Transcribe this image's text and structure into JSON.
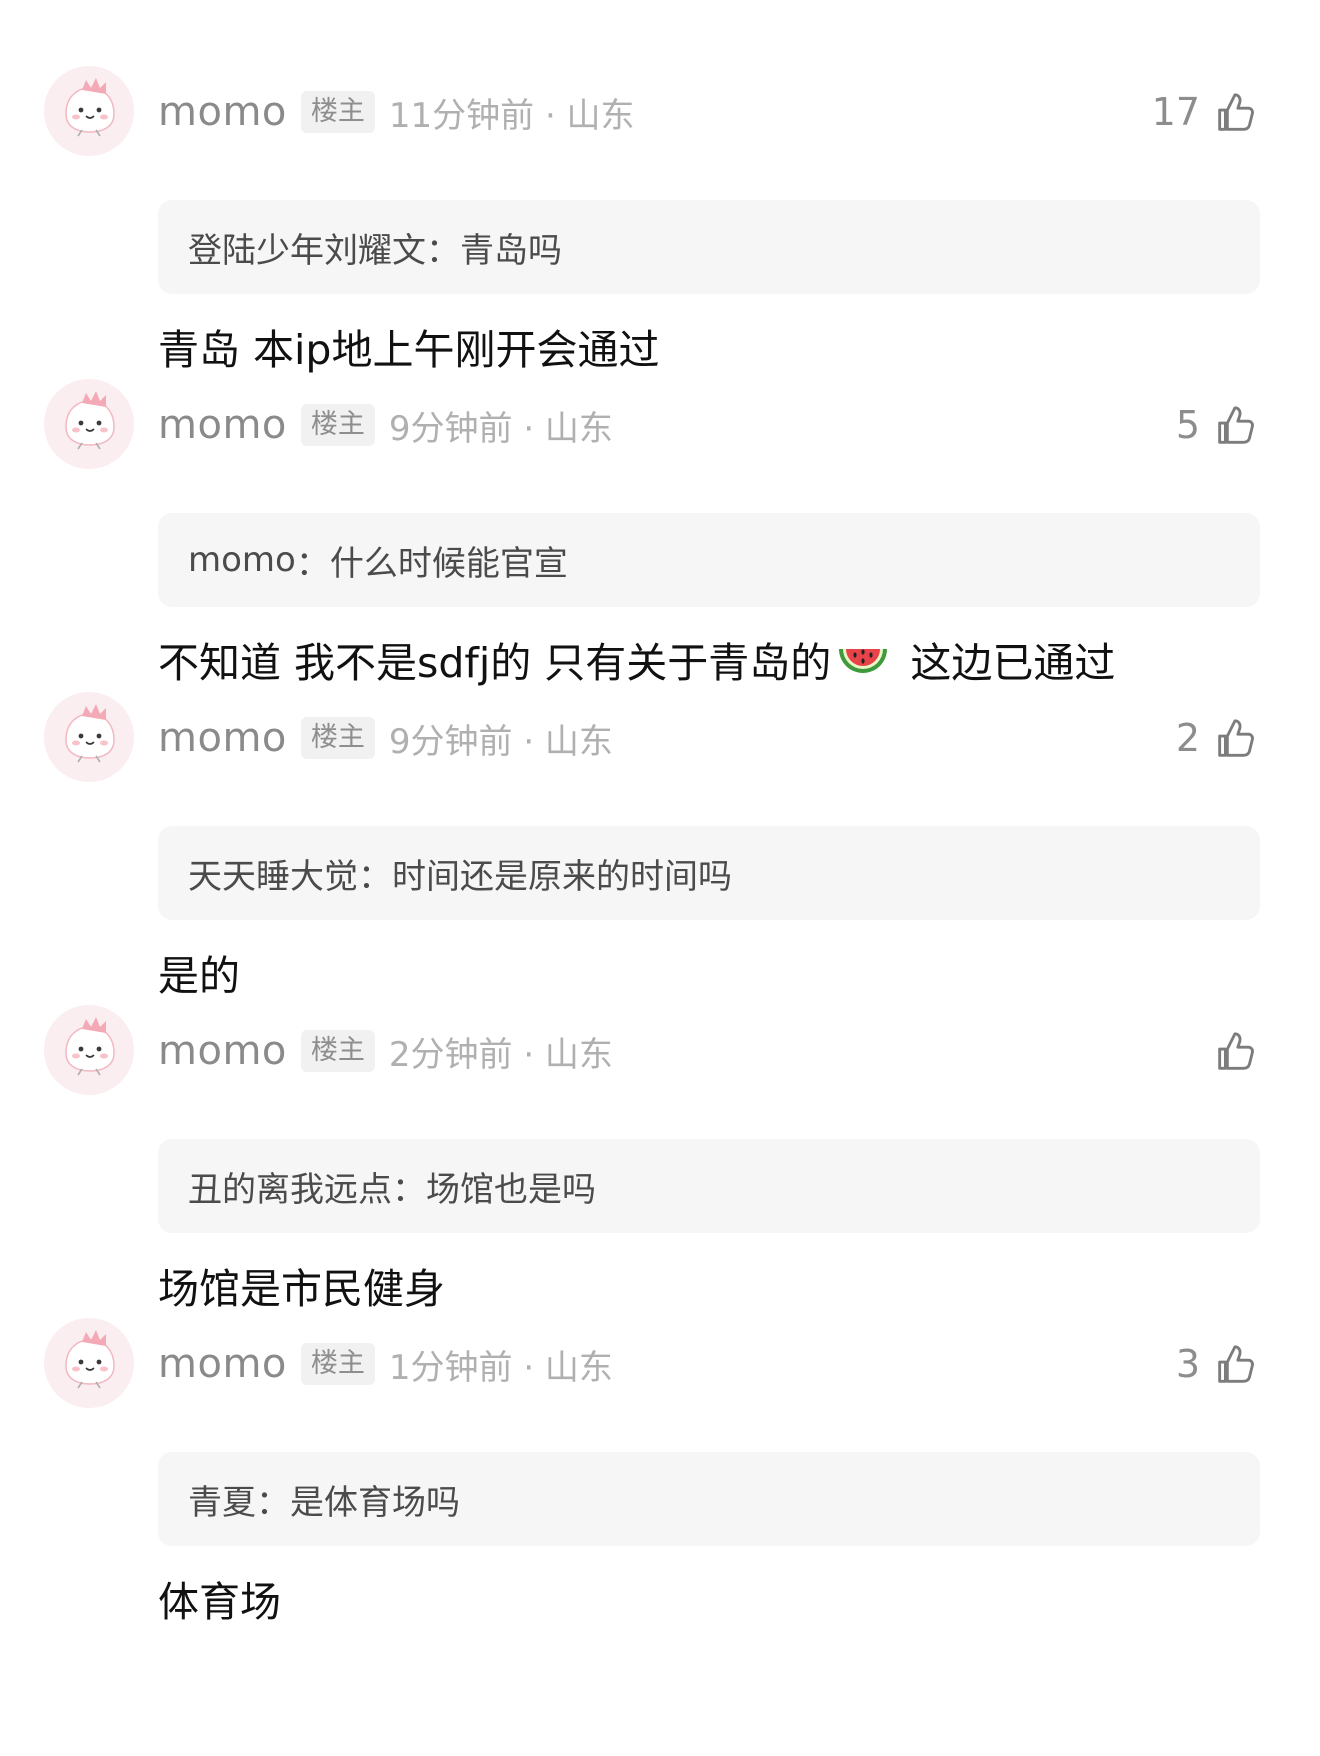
{
  "comments": [
    {
      "username": "momo",
      "badge": "楼主",
      "meta": "11分钟前 · 山东",
      "likes": "17",
      "quote_author": "登陆少年刘耀文",
      "quote_sep": "：",
      "quote_text": "青岛吗",
      "reply": "青岛 本ip地上午刚开会通过"
    },
    {
      "username": "momo",
      "badge": "楼主",
      "meta": "9分钟前 · 山东",
      "likes": "5",
      "quote_author": "momo",
      "quote_sep": "：",
      "quote_text": "什么时候能官宣",
      "reply_before_emoji": "不知道 我不是sdfj的 只有关于青岛的",
      "reply_emoji": "🍉",
      "reply_after_emoji": " 这边已通过"
    },
    {
      "username": "momo",
      "badge": "楼主",
      "meta": "9分钟前 · 山东",
      "likes": "2",
      "quote_author": "天天睡大觉",
      "quote_sep": "：",
      "quote_text": "时间还是原来的时间吗",
      "reply": "是的"
    },
    {
      "username": "momo",
      "badge": "楼主",
      "meta": "2分钟前 · 山东",
      "likes": "",
      "quote_author": "丑的离我远点",
      "quote_sep": "：",
      "quote_text": "场馆也是吗",
      "reply": "场馆是市民健身"
    },
    {
      "username": "momo",
      "badge": "楼主",
      "meta": "1分钟前 · 山东",
      "likes": "3",
      "quote_author": "青夏",
      "quote_sep": "：",
      "quote_text": "是体育场吗",
      "reply": "体育场"
    }
  ],
  "icons": {
    "like": "thumbs-up-icon",
    "avatar": "pink-dino-avatar"
  },
  "colors": {
    "avatar_bg": "#fbeef0",
    "avatar_accent": "#f4aab6",
    "quote_bg": "#f6f6f6",
    "meta_gray": "#b0b0b0",
    "username_gray": "#8a8a8a"
  }
}
